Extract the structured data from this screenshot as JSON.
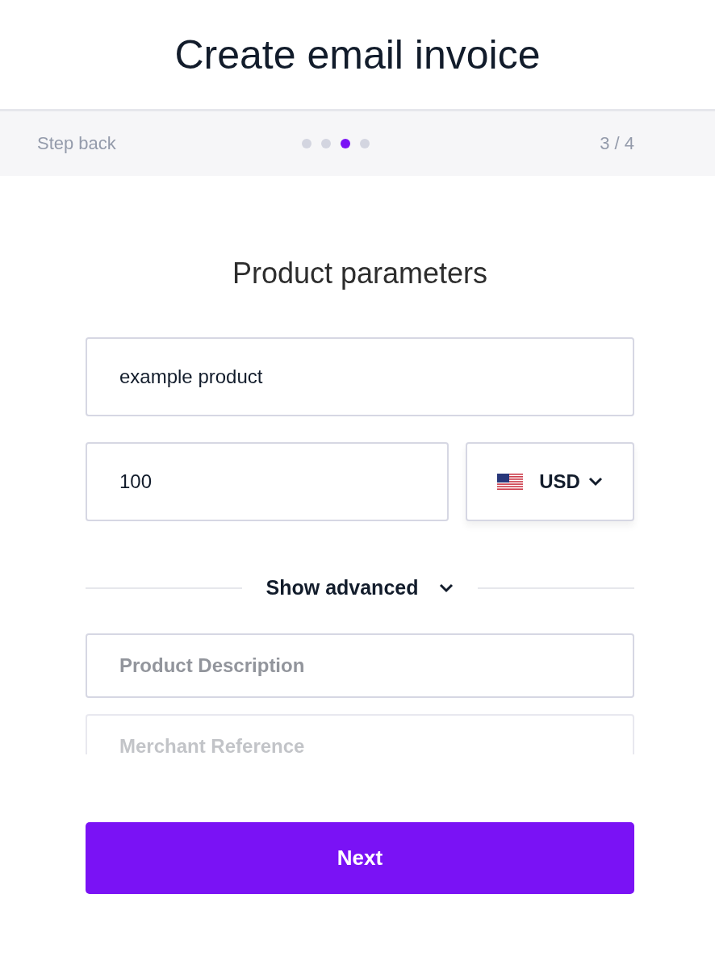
{
  "title": "Create email invoice",
  "stepbar": {
    "back": "Step back",
    "steps": [
      {
        "selected": false
      },
      {
        "selected": false
      },
      {
        "selected": true
      },
      {
        "selected": false
      }
    ],
    "counter": "3 / 4"
  },
  "heading": "Product parameters",
  "name_field": {
    "value": "example product"
  },
  "amount_field": {
    "value": "100"
  },
  "currency": {
    "code": "USD"
  },
  "advanced": {
    "label": "Show advanced",
    "expanded": false
  },
  "advanced_fields": [
    {
      "placeholder": "Product Description",
      "faded": false
    },
    {
      "placeholder": "Merchant Reference",
      "faded": true
    }
  ],
  "next_button": "Next"
}
